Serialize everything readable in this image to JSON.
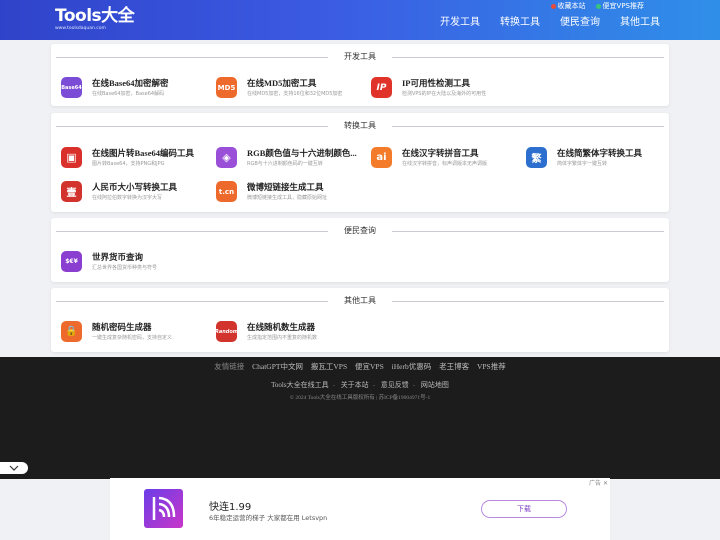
{
  "header": {
    "logo_text": "Tools大全",
    "logo_sub": "www.toolsdaquan.com",
    "top_links": [
      {
        "label": "收藏本站",
        "color": "#e84a3a"
      },
      {
        "label": "便宜VPS推荐",
        "color": "#3ac37a"
      }
    ],
    "nav": [
      "开发工具",
      "转换工具",
      "便民查询",
      "其他工具"
    ]
  },
  "sections": [
    {
      "title": "开发工具",
      "tools": [
        {
          "name": "在线Base64加密解密",
          "desc": "在线Base64加密，Base64解码",
          "icon_text": "Base64",
          "icon": "base64-icon",
          "color": "#7b4cd6"
        },
        {
          "name": "在线MD5加密工具",
          "desc": "在线MD5加密，支持16位和32位MD5加密",
          "icon_text": "MD5",
          "icon": "md5-icon",
          "color": "#ee6a2c"
        },
        {
          "name": "IP可用性检测工具",
          "desc": "检测VPS的IP在大陆以及海外的可用性",
          "icon_text": "IP",
          "icon": "ip-icon",
          "color": "#e0342b"
        }
      ]
    },
    {
      "title": "转换工具",
      "tools": [
        {
          "name": "在线图片转Base64编码工具",
          "desc": "图片转Base64，支持PNG和JPG",
          "icon_text": "▣",
          "icon": "image-base64-icon",
          "color": "#d9302c"
        },
        {
          "name": "RGB颜色值与十六进制颜色...",
          "desc": "RGB与十六进制颜色码的一键互转",
          "icon_text": "◈",
          "icon": "palette-icon",
          "color": "#9a4fd8"
        },
        {
          "name": "在线汉字转拼音工具",
          "desc": "在线汉字转拼音，标声调版本无声调版",
          "icon_text": "ai",
          "icon": "pinyin-icon",
          "color": "#f47b2a"
        },
        {
          "name": "在线简繁体字转换工具",
          "desc": "简体字繁体字一键互转",
          "icon_text": "繁",
          "icon": "traditional-chinese-icon",
          "color": "#2d6fcf"
        },
        {
          "name": "人民币大小写转换工具",
          "desc": "在线阿拉伯数字转换为汉字大写",
          "icon_text": "壹",
          "icon": "rmb-icon",
          "color": "#d2332d"
        },
        {
          "name": "微博短链接生成工具",
          "desc": "微博短链接生成工具，隐藏原始网址",
          "icon_text": "t.cn",
          "icon": "weibo-link-icon",
          "color": "#ee6a2c"
        }
      ]
    },
    {
      "title": "便民查询",
      "tools": [
        {
          "name": "世界货币查询",
          "desc": "汇总世界各国货币种类与符号",
          "icon_text": "$€¥",
          "icon": "currency-icon",
          "color": "#8a3fd0"
        }
      ]
    },
    {
      "title": "其他工具",
      "tools": [
        {
          "name": "随机密码生成器",
          "desc": "一键生成复杂随机密码，支持自定义",
          "icon_text": "🔒",
          "icon": "password-lock-icon",
          "color": "#ee6a2c"
        },
        {
          "name": "在线随机数生成器",
          "desc": "生成指定范围内不重复的随机数",
          "icon_text": "Random",
          "icon": "random-icon",
          "color": "#d2332d"
        }
      ]
    }
  ],
  "footer": {
    "friend_label": "友情链接",
    "friend_links": [
      "ChatGPT中文网",
      "搬瓦工VPS",
      "便宜VPS",
      "iHerb优惠码",
      "老王博客",
      "VPS推荐"
    ],
    "links": [
      "Tools大全在线工具",
      "关于本站",
      "意见反馈",
      "网站地图"
    ],
    "copyright": "© 2024 Tools大全在线工具版权所有 | 苏ICP备19004971号-1"
  },
  "ad": {
    "mark": "广告",
    "title": "快连1.99",
    "subtitle": "6年稳定运营的梯子 大家都在用 Letsvpn",
    "button": "下载"
  }
}
